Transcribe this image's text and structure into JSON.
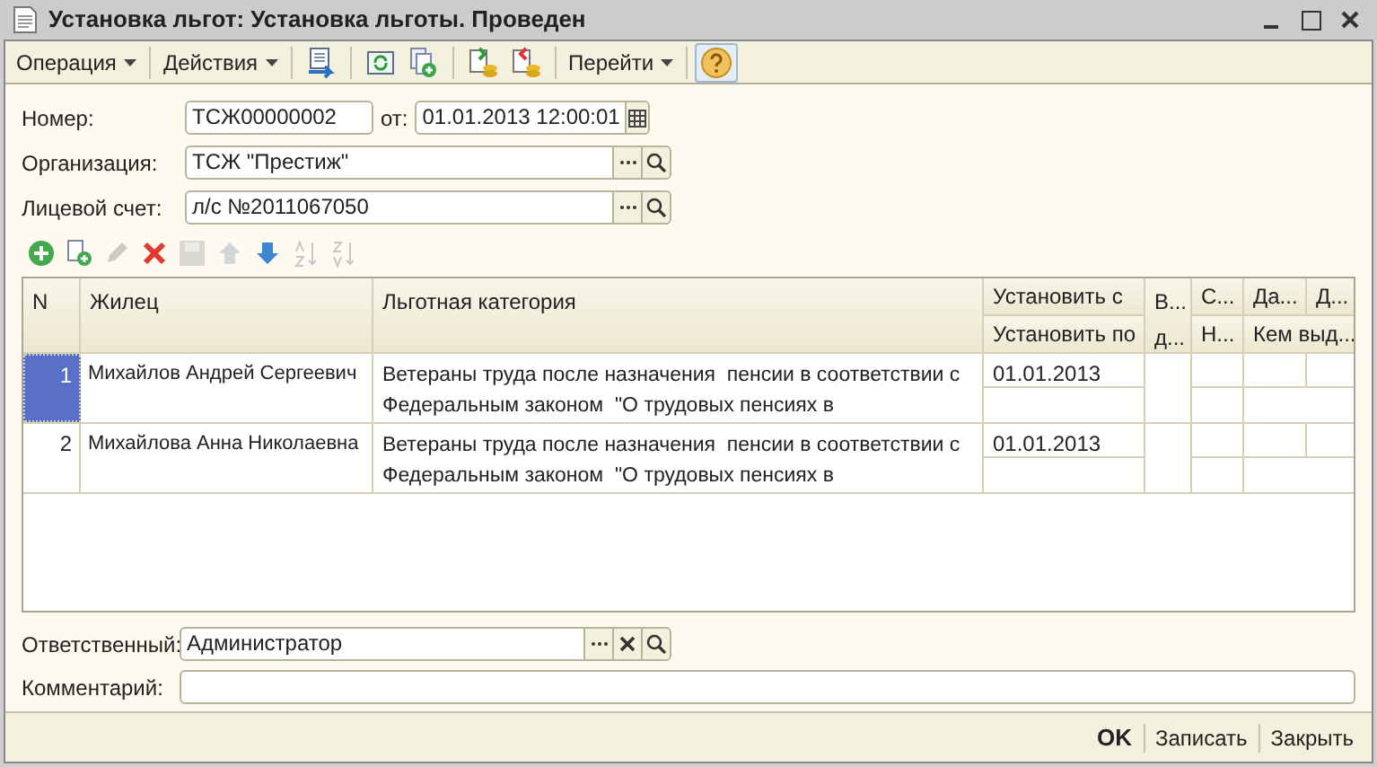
{
  "window": {
    "title": "Установка льгот: Установка льготы. Проведен"
  },
  "toolbar": {
    "items": [
      {
        "kind": "menu",
        "label": "Операция"
      },
      {
        "kind": "menu",
        "label": "Действия"
      },
      {
        "kind": "icon"
      },
      {
        "kind": "icon"
      },
      {
        "kind": "icon"
      },
      {
        "kind": "icon"
      },
      {
        "kind": "icon"
      },
      {
        "kind": "menu",
        "label": "Перейти"
      },
      {
        "kind": "icon"
      }
    ]
  },
  "header": {
    "number": {
      "label": "Номер:",
      "value": "ТСЖ00000002"
    },
    "date": {
      "label": "от:",
      "value": "01.01.2013 12:00:01"
    },
    "organization": {
      "label": "Организация:",
      "value": "ТСЖ \"Престиж\""
    },
    "account": {
      "label": "Лицевой счет:",
      "value": "л/с №2011067050"
    }
  },
  "table_toolbar": [
    {
      "disabled": false
    },
    {
      "disabled": false
    },
    {
      "disabled": true
    },
    {
      "disabled": false
    },
    {
      "disabled": true
    },
    {
      "disabled": true
    },
    {
      "disabled": false
    },
    {
      "disabled": true
    },
    {
      "disabled": true
    }
  ],
  "table": {
    "columns": [
      {
        "kind": "full",
        "title": "N"
      },
      {
        "kind": "full",
        "title": "Жилец"
      },
      {
        "kind": "full",
        "title": "Льготная категория"
      },
      {
        "kind": "split",
        "title": "Установить с",
        "subtitle": "Установить по"
      },
      {
        "kind": "full",
        "title": "В...",
        "title_2": "д..."
      },
      {
        "kind": "split",
        "title": "С...",
        "subtitle": "Н..."
      },
      {
        "kind": "top",
        "title": "Да..."
      },
      {
        "kind": "top",
        "title": "Д..."
      }
    ],
    "shared_subtitle": "Кем выд...",
    "rows": [
      {
        "n": "1",
        "selected": true,
        "resident": "Михайлов Андрей Сергеевич",
        "category": [
          "Ветераны труда после назначения  пенсии в соответствии с",
          "Федеральным законом  \"О трудовых пенсиях в"
        ],
        "set_from": "01.01.2013"
      },
      {
        "n": "2",
        "selected": false,
        "resident": "Михайлова Анна Николаевна",
        "category": [
          "Ветераны труда после назначения  пенсии в соответствии с",
          "Федеральным законом  \"О трудовых пенсиях в"
        ],
        "set_from": "01.01.2013"
      }
    ]
  },
  "responsible": {
    "label": "Ответственный:",
    "value": "Администратор"
  },
  "comment": {
    "label": "Комментарий:"
  },
  "footer": {
    "buttons": [
      {
        "kind": "default",
        "label": "OK"
      },
      {
        "kind": "plain",
        "label": "Записать"
      },
      {
        "kind": "plain",
        "label": "Закрыть"
      }
    ]
  }
}
